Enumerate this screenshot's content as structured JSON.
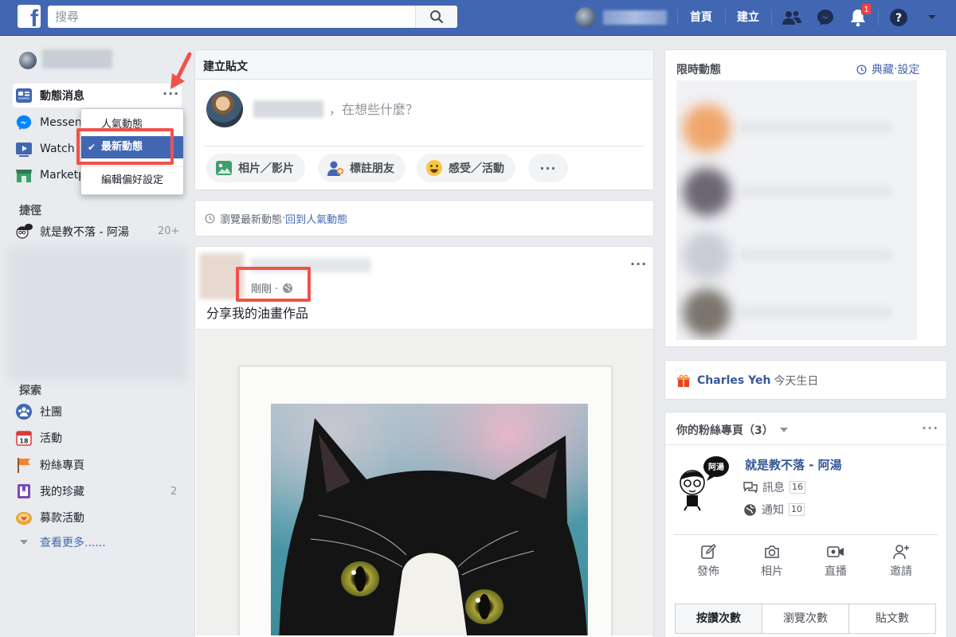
{
  "topbar": {
    "logo": "f",
    "search_placeholder": "搜尋",
    "home": "首頁",
    "create": "建立",
    "notification_count": "1"
  },
  "left": {
    "nav": [
      {
        "label": "動態消息",
        "icon": "news-feed-icon"
      },
      {
        "label": "Messenger",
        "icon": "messenger-icon"
      },
      {
        "label": "Watch",
        "icon": "watch-icon"
      },
      {
        "label": "Marketplace",
        "icon": "marketplace-icon"
      }
    ],
    "dropdown": {
      "top_posts": "人氣動態",
      "most_recent": "最新動態",
      "edit_preferences": "編輯偏好設定"
    },
    "shortcuts_title": "捷徑",
    "shortcut": {
      "label": "就是教不落 - 阿湯",
      "count": "20+"
    },
    "explore_title": "探索",
    "explore": [
      {
        "label": "社團",
        "count": ""
      },
      {
        "label": "活動",
        "count": ""
      },
      {
        "label": "粉絲專頁",
        "count": ""
      },
      {
        "label": "我的珍藏",
        "count": "2"
      },
      {
        "label": "募款活動",
        "count": ""
      }
    ],
    "see_more": "查看更多......",
    "calendar_day": "18"
  },
  "composer": {
    "title": "建立貼文",
    "prompt": "，在想些什麼？",
    "actions": [
      "相片／影片",
      "標註朋友",
      "感受／活動"
    ]
  },
  "feed_info": {
    "text": "瀏覽最新動態",
    "separator": " · ",
    "link": "回到人氣動態"
  },
  "post": {
    "time": "剛剛 ·",
    "text": "分享我的油畫作品"
  },
  "stories": {
    "title": "限時動態",
    "archive": "典藏",
    "separator": " · ",
    "settings": "設定"
  },
  "birthday": {
    "name": "Charles Yeh",
    "text": "今天生日"
  },
  "pages": {
    "title": "你的粉絲專頁（3）",
    "name": "就是教不落 - 阿湯",
    "avatar_badge": "阿湯",
    "messages_label": "訊息",
    "messages_count": "16",
    "notifications_label": "通知",
    "notifications_count": "10",
    "actions": [
      "發佈",
      "相片",
      "直播",
      "邀請"
    ],
    "tabs": [
      "按讚次數",
      "瀏覽次數",
      "貼文數"
    ]
  },
  "colors": {
    "brand": "#4267b2",
    "link": "#365899",
    "highlight": "#f0524a"
  }
}
